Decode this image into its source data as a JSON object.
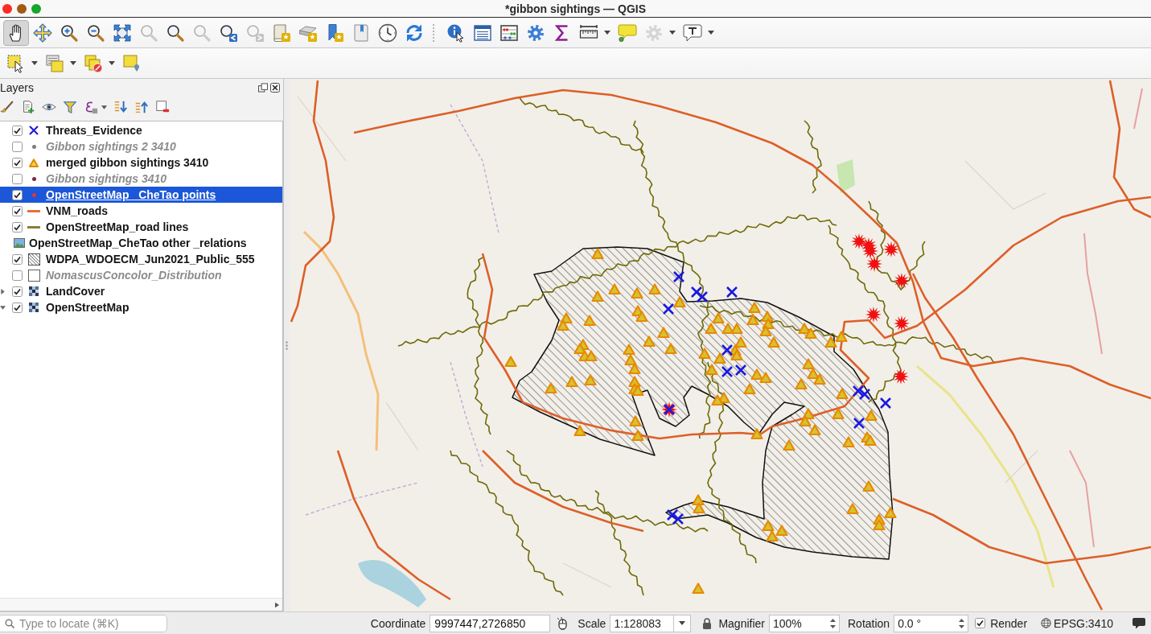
{
  "window": {
    "title": "*gibbon sightings — QGIS"
  },
  "toolbars": [
    {
      "groups": [
        {
          "tools": [
            {
              "kind": "pan",
              "selected": true,
              "disabled": false
            },
            {
              "kind": "pan-to-selection",
              "selected": false,
              "disabled": false
            },
            {
              "kind": "zoom-in",
              "selected": false,
              "disabled": false
            },
            {
              "kind": "zoom-out",
              "selected": false,
              "disabled": false
            },
            {
              "kind": "zoom-full",
              "selected": false,
              "disabled": false
            },
            {
              "kind": "zoom-to-selection",
              "selected": false,
              "disabled": true
            },
            {
              "kind": "zoom-to-layer",
              "selected": false,
              "disabled": false
            },
            {
              "kind": "zoom-native",
              "selected": false,
              "disabled": true
            },
            {
              "kind": "zoom-last",
              "selected": false,
              "disabled": false
            },
            {
              "kind": "zoom-next",
              "selected": false,
              "disabled": true
            },
            {
              "kind": "new-map-view",
              "selected": false,
              "disabled": false
            },
            {
              "kind": "new-3d-view",
              "selected": false,
              "disabled": false
            },
            {
              "kind": "new-bookmark",
              "selected": false,
              "disabled": false
            },
            {
              "kind": "show-bookmarks",
              "selected": false,
              "disabled": false
            },
            {
              "kind": "temporal",
              "selected": false,
              "disabled": false
            },
            {
              "kind": "refresh",
              "selected": false,
              "disabled": false
            }
          ]
        },
        {
          "tools": [
            {
              "kind": "identify",
              "selected": false,
              "disabled": false
            },
            {
              "kind": "attribute-table",
              "selected": false,
              "disabled": false
            },
            {
              "kind": "statistics",
              "selected": false,
              "disabled": false
            },
            {
              "kind": "processing",
              "selected": false,
              "disabled": false
            },
            {
              "kind": "summary",
              "selected": false,
              "disabled": false
            },
            {
              "kind": "measure",
              "selected": false,
              "disabled": false,
              "dropdown": true
            },
            {
              "kind": "map-tips",
              "selected": false,
              "disabled": false
            },
            {
              "kind": "action",
              "selected": false,
              "disabled": true,
              "dropdown": true
            },
            {
              "kind": "annotation",
              "selected": false,
              "disabled": false,
              "dropdown": true
            }
          ]
        }
      ]
    },
    {
      "groups": [
        {
          "tools": [
            {
              "kind": "select",
              "selected": false,
              "disabled": false,
              "dropdown": true
            },
            {
              "kind": "select-by-value",
              "selected": false,
              "disabled": false,
              "dropdown": true
            },
            {
              "kind": "deselect",
              "selected": false,
              "disabled": false,
              "dropdown": true
            },
            {
              "kind": "select-by-location",
              "selected": false,
              "disabled": false
            }
          ]
        }
      ]
    }
  ],
  "layers_panel": {
    "title": "Layers",
    "items": [
      {
        "name": "Threats_Evidence",
        "kind": "layer",
        "checked": true,
        "selected": false,
        "symbol": {
          "kind": "cross",
          "color": "#1f1fd8"
        }
      },
      {
        "name": "Gibbon sightings 2 3410",
        "kind": "layer",
        "checked": false,
        "selected": false,
        "symbol": {
          "kind": "dot",
          "color": "#7f7f7f"
        }
      },
      {
        "name": "merged gibbon sightings 3410",
        "kind": "layer",
        "checked": true,
        "selected": false,
        "symbol": {
          "kind": "triangle",
          "color": "#e08a00"
        }
      },
      {
        "name": "Gibbon sightings 3410",
        "kind": "layer",
        "checked": false,
        "selected": false,
        "symbol": {
          "kind": "dot",
          "color": "#7a2348"
        }
      },
      {
        "name": "OpenStreetMap_ CheTao points",
        "kind": "layer",
        "checked": true,
        "selected": true,
        "symbol": {
          "kind": "dot",
          "color": "#e8333a"
        }
      },
      {
        "name": "VNM_roads",
        "kind": "layer",
        "checked": true,
        "selected": false,
        "symbol": {
          "kind": "line",
          "color": "#e2703a"
        }
      },
      {
        "name": "OpenStreetMap_road lines",
        "kind": "layer",
        "checked": true,
        "selected": false,
        "symbol": {
          "kind": "line",
          "color": "#8a7d3a"
        }
      },
      {
        "name": "OpenStreetMap_CheTao other _relations",
        "kind": "table",
        "selected": false,
        "symbol": {
          "kind": "image"
        }
      },
      {
        "name": "WDPA_WDOECM_Jun2021_Public_555",
        "kind": "layer",
        "checked": true,
        "selected": false,
        "symbol": {
          "kind": "hatch"
        }
      },
      {
        "name": "NomascusConcolor_Distribution",
        "kind": "layer",
        "checked": false,
        "selected": false,
        "symbol": {
          "kind": "outline"
        }
      },
      {
        "name": "LandCover",
        "kind": "layer",
        "checked": true,
        "selected": false,
        "expanded": false,
        "symbol": {
          "kind": "raster"
        }
      },
      {
        "name": "OpenStreetMap",
        "kind": "layer",
        "checked": true,
        "selected": false,
        "expanded": true,
        "symbol": {
          "kind": "raster"
        }
      }
    ]
  },
  "status_bar": {
    "locate": {
      "placeholder": "Type to locate (⌘K)"
    },
    "coordinate": {
      "label": "Coordinate",
      "value": "9997447,2726850"
    },
    "scale": {
      "label": "Scale",
      "value": "1:128083"
    },
    "magnifier": {
      "label": "Magnifier",
      "value": "100%"
    },
    "rotation": {
      "label": "Rotation",
      "value": "0.0 °"
    },
    "render": {
      "label": "Render",
      "checked": true
    },
    "crs": "EPSG:3410"
  }
}
